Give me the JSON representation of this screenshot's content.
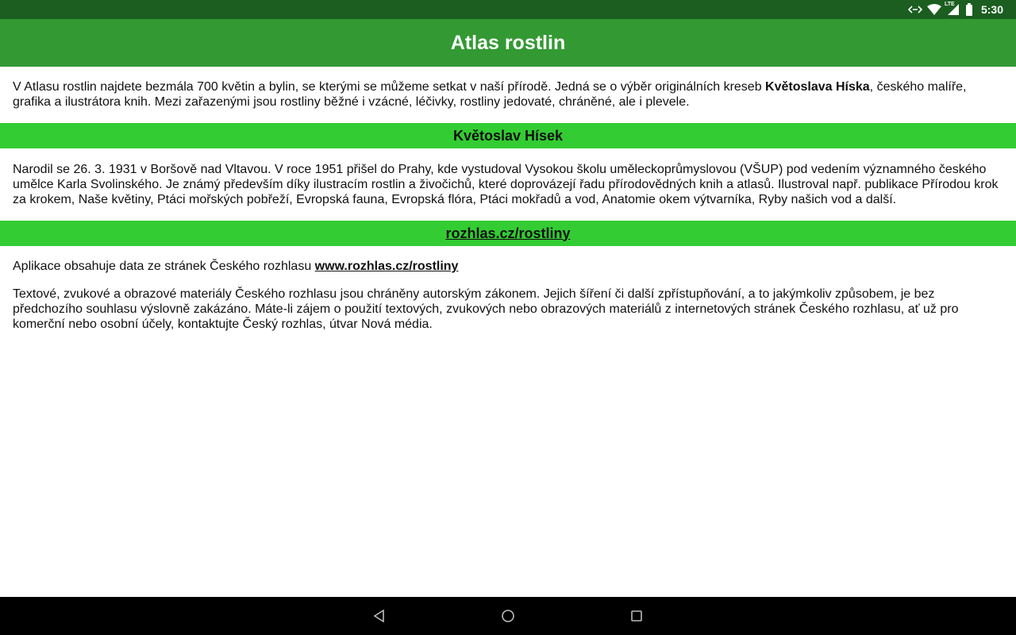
{
  "status_bar": {
    "time": "5:30",
    "icons": [
      "data-arrows-icon",
      "wifi-icon",
      "lte-signal-icon",
      "battery-icon"
    ],
    "lte_label": "LTE"
  },
  "app_bar": {
    "title": "Atlas rostlin"
  },
  "intro": {
    "text_before": "V Atlasu rostlin najdete bezmála 700 květin a bylin, se kterými se můžeme setkat v naší přírodě. Jedná se o výběr originálních kreseb ",
    "author_bold": "Květoslava Híska",
    "text_after": ", českého malíře, grafika a ilustrátora knih. Mezi zařazenými jsou rostliny běžné i vzácné, léčivky, rostliny jedovaté, chráněné, ale i plevele."
  },
  "section_author": {
    "header": "Květoslav Hísek",
    "bio": "Narodil se 26. 3. 1931 v Boršově nad Vltavou. V roce 1951 přišel do Prahy, kde vystudoval Vysokou školu uměleckoprůmyslovou (VŠUP) pod vedením významného českého umělce Karla Svolinského. Je známý především díky ilustracím rostlin a živočichů, které doprovázejí řadu přírodovědných knih a atlasů. Ilustroval např. publikace Přírodou krok za krokem, Naše květiny, Ptáci mořských pobřeží, Evropská fauna, Evropská flóra, Ptáci mokřadů a vod, Anatomie okem výtvarníka, Ryby našich vod a další."
  },
  "section_source": {
    "header_link": "rozhlas.cz/rostliny",
    "data_text": "Aplikace obsahuje data ze stránek Českého rozhlasu ",
    "data_link": "www.rozhlas.cz/rostliny",
    "copyright": "Textové, zvukové a obrazové materiály Českého rozhlasu jsou chráněny autorským zákonem. Jejich šíření či další zpřístupňování, a to jakýmkoliv způsobem, je bez předchozího souhlasu výslovně zakázáno. Máte-li zájem o použití textových, zvukových nebo obrazových materiálů z internetových stránek Českého rozhlasu, ať už pro komerční nebo osobní účely, kontaktujte Český rozhlas, útvar Nová média."
  },
  "nav_bar": {
    "buttons": [
      "back-icon",
      "home-icon",
      "recents-icon"
    ]
  },
  "colors": {
    "status_bar": "#1b5e20",
    "app_bar": "#339933",
    "section_header": "#33cc33",
    "nav_bar": "#000000"
  }
}
